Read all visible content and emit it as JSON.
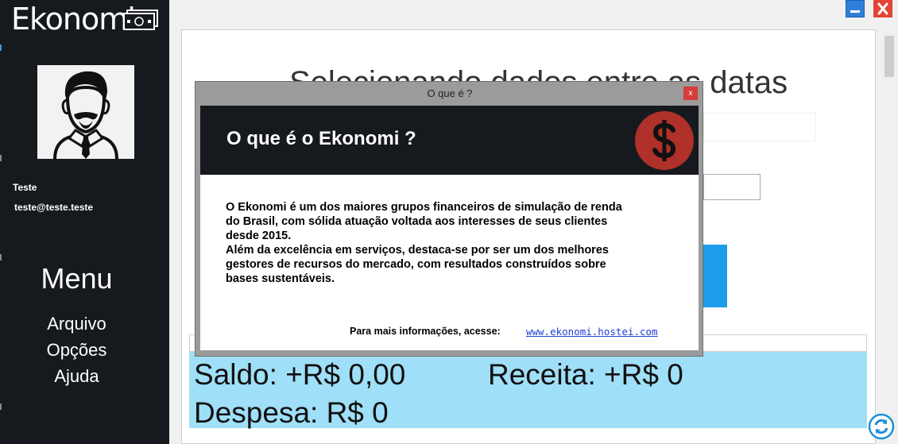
{
  "sidebar": {
    "brand": "Ekonomi",
    "brand_icon": "money-icon",
    "avatar_icon": "user-avatar-icon",
    "user_name": "Teste",
    "user_email": "teste@teste.teste",
    "menu_title": "Menu",
    "menu_items": [
      {
        "label": "Arquivo"
      },
      {
        "label": "Opções"
      },
      {
        "label": "Ajuda"
      }
    ]
  },
  "window": {
    "minimize_icon": "minimize-icon",
    "close_icon": "close-icon"
  },
  "main": {
    "page_title": "Selecionando dados entre as datas",
    "summary": {
      "saldo": "Saldo: +R$ 0,00",
      "receita": "Receita: +R$ 0",
      "despesa": "Despesa: R$ 0"
    },
    "refresh_icon": "refresh-icon"
  },
  "modal": {
    "title": "O que é ?",
    "close_label": "x",
    "heading": "O que é o Ekonomi ?",
    "heading_icon": "dollar-icon",
    "body_lines": [
      " O Ekonomi é um dos maiores grupos financeiros de simulação de renda",
      "do Brasil, com sólida atuação voltada aos interesses de seus clientes",
      "desde 2015.",
      " Além da excelência em serviços, destaca-se por ser um dos melhores",
      "gestores de recursos do mercado, com resultados construídos sobre",
      "bases sustentáveis."
    ],
    "more_info_label": "Para mais informações, acesse:",
    "more_info_link": "www.ekonomi.hostei.com"
  },
  "colors": {
    "sidebar_bg": "#16191d",
    "summary_bg": "#9fdff7",
    "accent_blue": "#1e9bea",
    "close_red": "#e34234",
    "dollar_red": "#b0302a"
  }
}
